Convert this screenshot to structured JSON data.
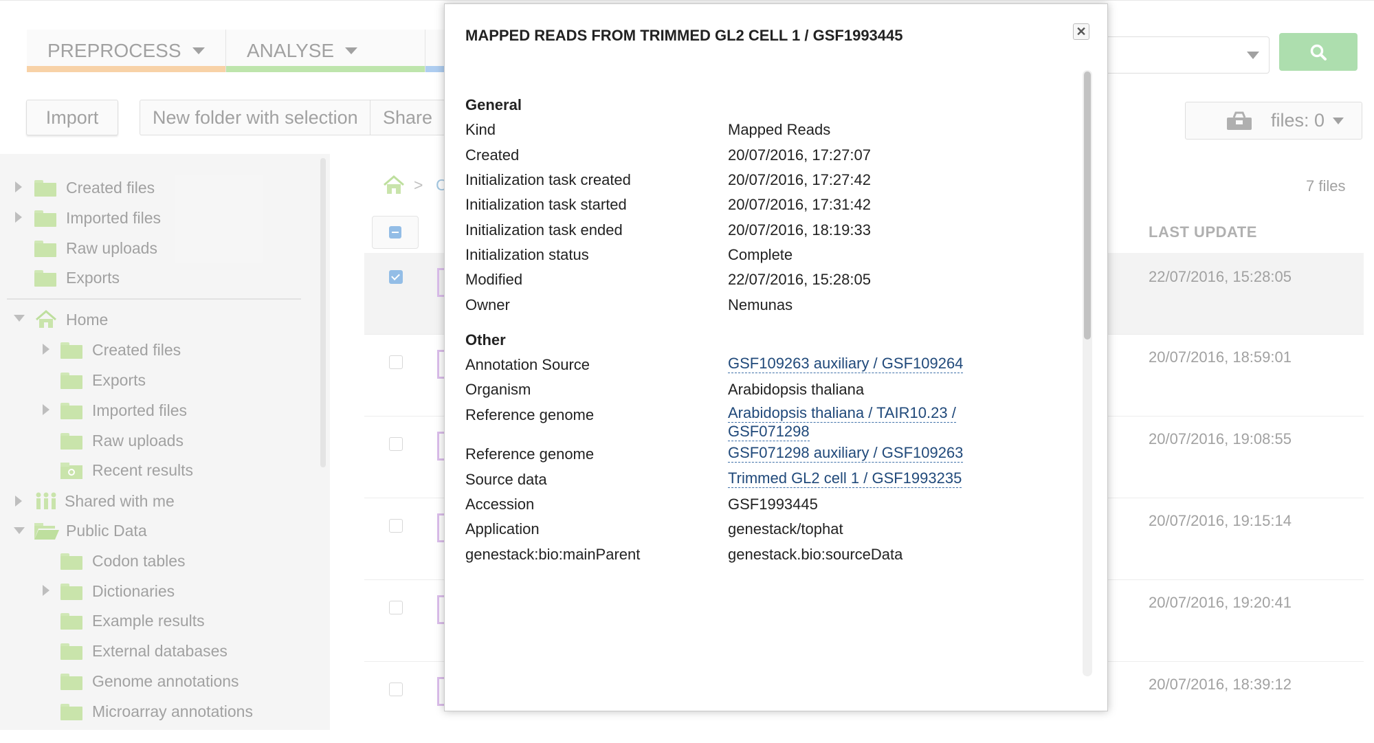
{
  "toolbar": {
    "tab_preprocess": "PREPROCESS",
    "tab_analyse": "ANALYSE",
    "import_label": "Import",
    "new_folder_label": "New folder with selection",
    "share_label": "Share",
    "files_label": "files: 0"
  },
  "colors": {
    "preprocess": "#f8cfa0",
    "analyse": "#b9e3a5",
    "third": "#a8c9ef",
    "search_button": "#a6dca8",
    "link": "#20497a"
  },
  "icons": [
    "search-icon",
    "basket-icon",
    "folder-icon",
    "home-icon",
    "shared-users-icon",
    "recent-results-icon",
    "close-icon"
  ],
  "sidebar": {
    "items": [
      {
        "label": "Created files"
      },
      {
        "label": "Imported files"
      },
      {
        "label": "Raw uploads"
      },
      {
        "label": "Exports"
      },
      {
        "label": "Home"
      },
      {
        "label": "Created files"
      },
      {
        "label": "Exports"
      },
      {
        "label": "Imported files"
      },
      {
        "label": "Raw uploads"
      },
      {
        "label": "Recent results"
      },
      {
        "label": "Shared with me"
      },
      {
        "label": "Public Data"
      },
      {
        "label": "Codon tables"
      },
      {
        "label": "Dictionaries"
      },
      {
        "label": "Example results"
      },
      {
        "label": "External databases"
      },
      {
        "label": "Genome annotations"
      },
      {
        "label": "Microarray annotations"
      }
    ]
  },
  "main": {
    "breadcrumb_sep": ">",
    "breadcrumb_partial": "C",
    "file_count": "7 files",
    "col_last_update": "LAST UPDATE",
    "rows": [
      {
        "date": "22/07/2016, 15:28:05",
        "selected": true
      },
      {
        "date": "20/07/2016, 18:59:01",
        "selected": false
      },
      {
        "date": "20/07/2016, 19:08:55",
        "selected": false
      },
      {
        "date": "20/07/2016, 19:15:14",
        "selected": false
      },
      {
        "date": "20/07/2016, 19:20:41",
        "selected": false
      },
      {
        "date": "20/07/2016, 18:39:12",
        "selected": false
      }
    ]
  },
  "modal": {
    "title": "MAPPED READS FROM TRIMMED GL2 CELL 1 / GSF1993445",
    "close_glyph": "✕",
    "general_heading": "General",
    "general": [
      {
        "label": "Kind",
        "value": "Mapped Reads"
      },
      {
        "label": "Created",
        "value": "20/07/2016, 17:27:07"
      },
      {
        "label": "Initialization task created",
        "value": "20/07/2016, 17:27:42"
      },
      {
        "label": "Initialization task started",
        "value": "20/07/2016, 17:31:42"
      },
      {
        "label": "Initialization task ended",
        "value": "20/07/2016, 18:19:33"
      },
      {
        "label": "Initialization status",
        "value": "Complete"
      },
      {
        "label": "Modified",
        "value": "22/07/2016, 15:28:05"
      },
      {
        "label": "Owner",
        "value": "Nemunas"
      }
    ],
    "other_heading": "Other",
    "other": [
      {
        "label": "Annotation Source",
        "value": "GSF109263 auxiliary / GSF109264",
        "link": true
      },
      {
        "label": "Organism",
        "value": "Arabidopsis thaliana",
        "link": false
      },
      {
        "label": "Reference genome",
        "value_line1": "Arabidopsis thaliana / TAIR10.23 /",
        "value_line2": "GSF071298",
        "link": true
      },
      {
        "label": "Reference genome",
        "value": "GSF071298 auxiliary / GSF109263",
        "link": true
      },
      {
        "label": "Source data",
        "value": "Trimmed GL2 cell 1 / GSF1993235",
        "link": true
      },
      {
        "label": "Accession",
        "value": "GSF1993445",
        "link": false
      },
      {
        "label": "Application",
        "value": "genestack/tophat",
        "link": false
      },
      {
        "label": "genestack:bio:mainParent",
        "value": "genestack.bio:sourceData",
        "link": false
      }
    ]
  }
}
